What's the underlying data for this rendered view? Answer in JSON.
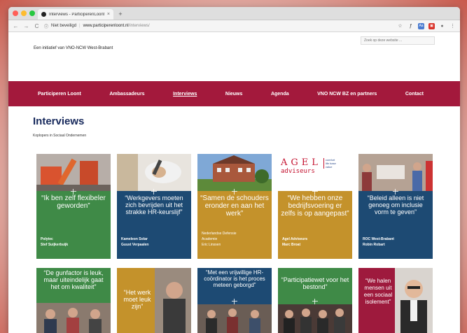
{
  "browser": {
    "tab_title": "Interviews - ParticiperenLoont",
    "tab_close": "×",
    "new_tab": "+",
    "security_label": "Niet beveiligd",
    "url_host": "www.participerenloont.nl",
    "url_path": "/interviews/",
    "nav_back": "←",
    "nav_forward": "→",
    "nav_reload": "C",
    "icons": [
      "star-icon",
      "font-icon",
      "translate-icon",
      "extension-icon",
      "profile-icon",
      "menu-icon"
    ],
    "traffic_colors": [
      "#ff5f57",
      "#febc2e",
      "#28c840"
    ]
  },
  "header": {
    "tagline": "Een initiatief van VNO-NCW West-Brabant",
    "search_placeholder": "Zoek op deze website ..."
  },
  "nav": {
    "items": [
      "Participeren Loont",
      "Ambassadeurs",
      "Interviews",
      "Nieuws",
      "Agenda",
      "VNO NCW BZ en partners",
      "Contact"
    ],
    "active": "Interviews",
    "color": "#a3193c"
  },
  "page": {
    "title": "Interviews",
    "subtitle": "Koplopers in Sociaal Ondernemen"
  },
  "colors": {
    "green": "#3f8a47",
    "navy": "#1d4a73",
    "gold": "#c4922b",
    "maroon": "#9e1a3d"
  },
  "cards_row1": [
    {
      "quote": "“Ik ben zelf flexibeler geworden”",
      "org": "Polytec",
      "person": "Stef Suijkerbuijk"
    },
    {
      "quote": "“Werkgevers moeten zich bevrijden uit het strakke HR-keurslijf”",
      "org": "Kameleon Solar",
      "person": "Guust Verpaalen"
    },
    {
      "quote": "“Samen de schouders eronder en aan het werk”",
      "org": "Nederlandse Defensie Academie",
      "person": "Eric Linssen"
    },
    {
      "quote": "“We hebben onze bedrijfsvoering er zelfs is op aangepast”",
      "org": "Agel Adviseurs",
      "person": "Marc Broat",
      "logo_main": "AGEL",
      "logo_sub": "adviseurs",
      "logo_tag": "comfort life base value"
    },
    {
      "quote": "“Beleid alleen is niet genoeg om inclusie vorm te geven”",
      "org": "ROC West-Brabant",
      "person": "Robin Robart"
    }
  ],
  "cards_row2": [
    {
      "quote": "“De gunfactor is leuk, maar uiteindelijk gaat het om kwaliteit”"
    },
    {
      "quote": "“Het werk moet leuk zijn”"
    },
    {
      "quote": "“Met een vrijwillige HR-coördinator is het proces meteen geborgd”"
    },
    {
      "quote": "“Participatiewet voor het bestond”"
    },
    {
      "quote": "“We halen mensen uit een sociaal isolement”"
    }
  ]
}
